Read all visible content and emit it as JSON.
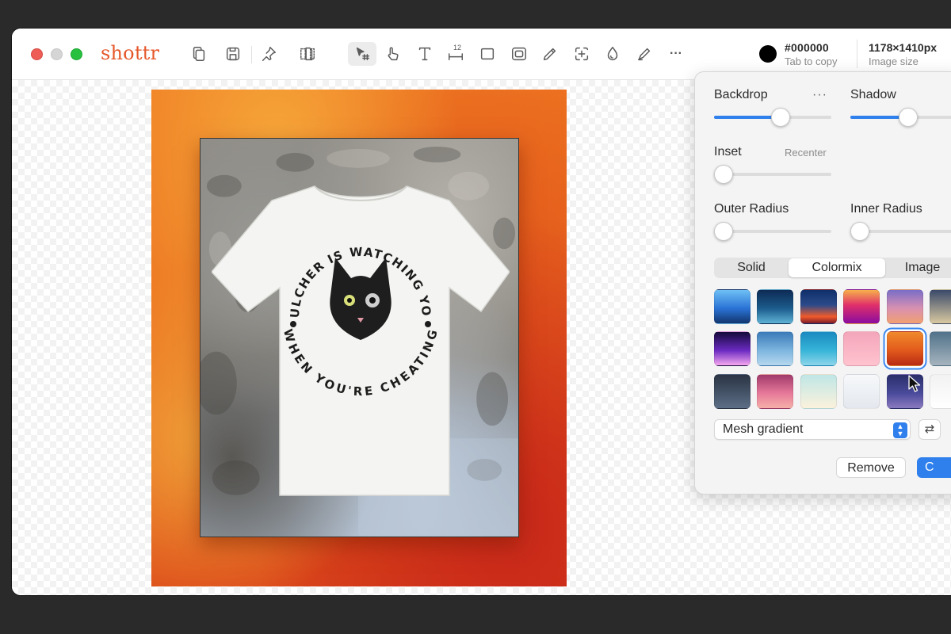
{
  "app": {
    "name": "shottr"
  },
  "toolbar": {
    "tools": [
      {
        "name": "copy-icon"
      },
      {
        "name": "save-icon"
      },
      {
        "name": "pin-icon"
      },
      {
        "name": "layers-icon"
      },
      {
        "name": "select-tool-icon"
      },
      {
        "name": "pointer-icon"
      },
      {
        "name": "text-icon"
      },
      {
        "name": "ruler-icon"
      },
      {
        "name": "rectangle-icon"
      },
      {
        "name": "blur-icon"
      },
      {
        "name": "pencil-icon"
      },
      {
        "name": "crop-icon"
      },
      {
        "name": "drop-icon"
      },
      {
        "name": "highlighter-icon"
      },
      {
        "name": "more-icon"
      }
    ],
    "ruler_number": "12",
    "more_label": "···"
  },
  "color": {
    "hex": "#000000",
    "hint": "Tab to copy",
    "value": "#000000"
  },
  "image_size": {
    "value": "1178×1410px",
    "label": "Image size"
  },
  "tshirt": {
    "top_text": "PULCHER IS WATCHING YOU",
    "bottom_text": "WHEN YOU'RE CHEATING"
  },
  "panel": {
    "backdrop_label": "Backdrop",
    "backdrop_more": "···",
    "shadow_label": "Shadow",
    "inset_label": "Inset",
    "recenter_label": "Recenter",
    "outer_radius_label": "Outer Radius",
    "inner_radius_label": "Inner Radius",
    "backdrop_level": 0.57,
    "shadow_level": 0.5,
    "inset_level": 0.0,
    "outer_radius_level": 0.0,
    "inner_radius_level": 0.0,
    "tabs": [
      "Solid",
      "Colormix",
      "Image"
    ],
    "selected_tab": "Colormix",
    "selected_swatch": "row2-col5",
    "gradient_type": "Mesh gradient",
    "remove_label": "Remove",
    "primary_label": "C",
    "swap_icon": "swap-arrows-icon"
  }
}
